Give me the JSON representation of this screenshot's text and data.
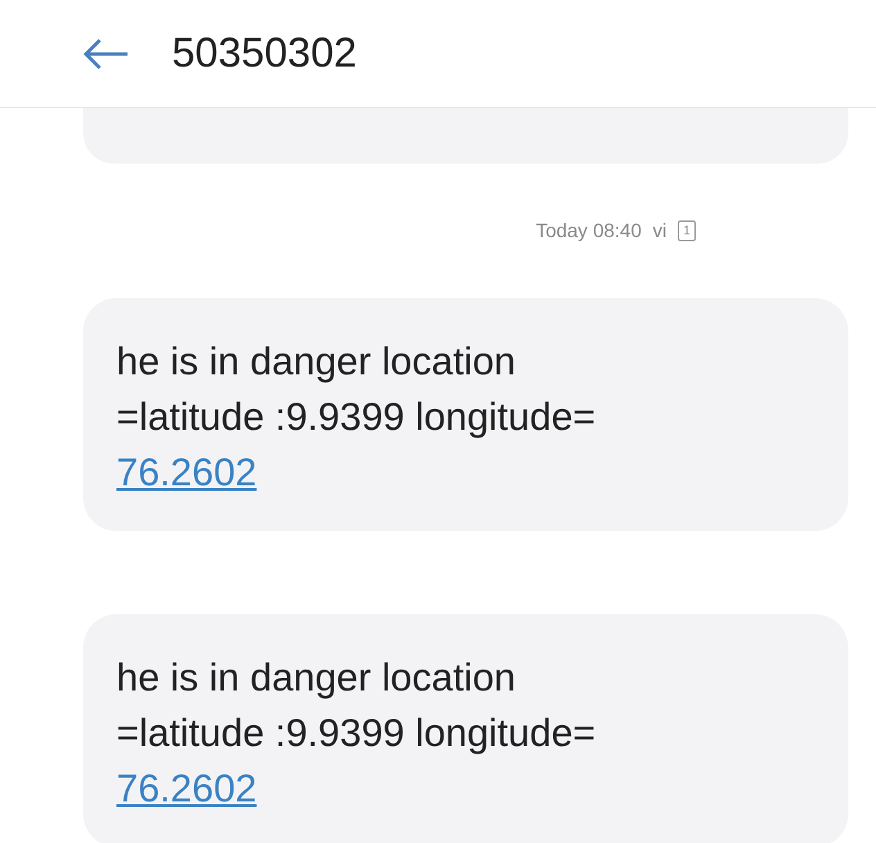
{
  "header": {
    "title": "50350302"
  },
  "timestamp": {
    "text": "Today 08:40",
    "suffix": "vi",
    "sim_slot": "1"
  },
  "messages": [
    {
      "lines": [
        "he is in danger location",
        "=latitude :9.9399 longitude="
      ],
      "link": "76.2602"
    },
    {
      "lines": [
        "he is in danger location",
        "=latitude :9.9399 longitude="
      ],
      "link": "76.2602"
    }
  ]
}
